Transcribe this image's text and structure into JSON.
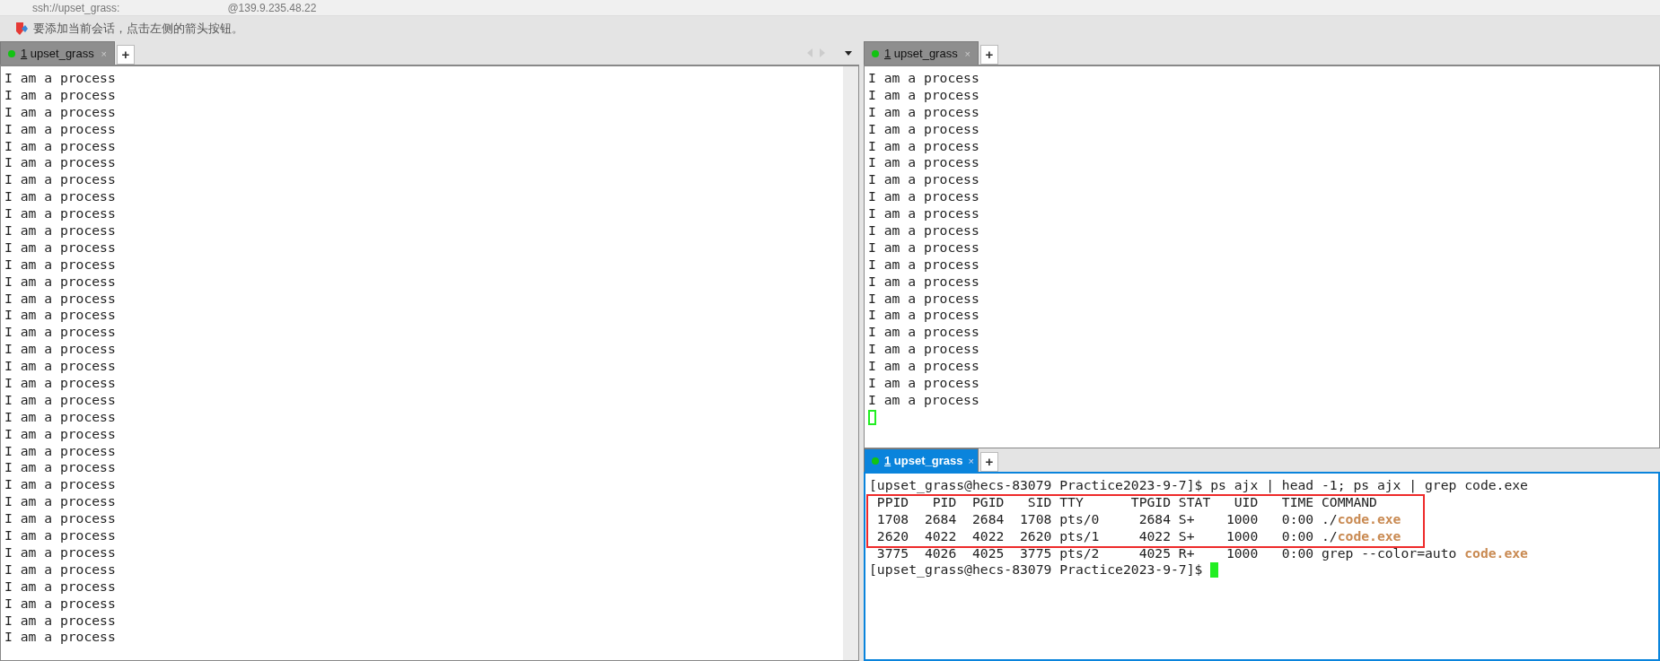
{
  "session_bar": {
    "host": "ssh://upset_grass:",
    "address": "@139.9.235.48.22"
  },
  "hint_bar": {
    "text": "要添加当前会话，点击左侧的箭头按钮。"
  },
  "left_pane": {
    "focused": false,
    "scrollbar": true,
    "tab_nav": true,
    "tabs": [
      {
        "number": "1",
        "label": "upset_grass",
        "close": "×",
        "selected": true
      }
    ],
    "new_tab": "+",
    "lines": [
      [
        {
          "text": "I am a process",
          "kind": "plain"
        }
      ],
      [
        {
          "text": "I am a process",
          "kind": "plain"
        }
      ],
      [
        {
          "text": "I am a process",
          "kind": "plain"
        }
      ],
      [
        {
          "text": "I am a process",
          "kind": "plain"
        }
      ],
      [
        {
          "text": "I am a process",
          "kind": "plain"
        }
      ],
      [
        {
          "text": "I am a process",
          "kind": "plain"
        }
      ],
      [
        {
          "text": "I am a process",
          "kind": "plain"
        }
      ],
      [
        {
          "text": "I am a process",
          "kind": "plain"
        }
      ],
      [
        {
          "text": "I am a process",
          "kind": "plain"
        }
      ],
      [
        {
          "text": "I am a process",
          "kind": "plain"
        }
      ],
      [
        {
          "text": "I am a process",
          "kind": "plain"
        }
      ],
      [
        {
          "text": "I am a process",
          "kind": "plain"
        }
      ],
      [
        {
          "text": "I am a process",
          "kind": "plain"
        }
      ],
      [
        {
          "text": "I am a process",
          "kind": "plain"
        }
      ],
      [
        {
          "text": "I am a process",
          "kind": "plain"
        }
      ],
      [
        {
          "text": "I am a process",
          "kind": "plain"
        }
      ],
      [
        {
          "text": "I am a process",
          "kind": "plain"
        }
      ],
      [
        {
          "text": "I am a process",
          "kind": "plain"
        }
      ],
      [
        {
          "text": "I am a process",
          "kind": "plain"
        }
      ],
      [
        {
          "text": "I am a process",
          "kind": "plain"
        }
      ],
      [
        {
          "text": "I am a process",
          "kind": "plain"
        }
      ],
      [
        {
          "text": "I am a process",
          "kind": "plain"
        }
      ],
      [
        {
          "text": "I am a process",
          "kind": "plain"
        }
      ],
      [
        {
          "text": "I am a process",
          "kind": "plain"
        }
      ],
      [
        {
          "text": "I am a process",
          "kind": "plain"
        }
      ],
      [
        {
          "text": "I am a process",
          "kind": "plain"
        }
      ],
      [
        {
          "text": "I am a process",
          "kind": "plain"
        }
      ],
      [
        {
          "text": "I am a process",
          "kind": "plain"
        }
      ],
      [
        {
          "text": "I am a process",
          "kind": "plain"
        }
      ],
      [
        {
          "text": "I am a process",
          "kind": "plain"
        }
      ],
      [
        {
          "text": "I am a process",
          "kind": "plain"
        }
      ],
      [
        {
          "text": "I am a process",
          "kind": "plain"
        }
      ],
      [
        {
          "text": "I am a process",
          "kind": "plain"
        }
      ],
      [
        {
          "text": "I am a process",
          "kind": "plain"
        }
      ]
    ]
  },
  "right_panes": [
    {
      "focused": false,
      "tabs": [
        {
          "number": "1",
          "label": "upset_grass",
          "close": "×",
          "selected": true
        }
      ],
      "new_tab": "+",
      "cursor_shown": true,
      "cursor_filled": false,
      "lines": [
        [
          {
            "text": "I am a process",
            "kind": "plain"
          }
        ],
        [
          {
            "text": "I am a process",
            "kind": "plain"
          }
        ],
        [
          {
            "text": "I am a process",
            "kind": "plain"
          }
        ],
        [
          {
            "text": "I am a process",
            "kind": "plain"
          }
        ],
        [
          {
            "text": "I am a process",
            "kind": "plain"
          }
        ],
        [
          {
            "text": "I am a process",
            "kind": "plain"
          }
        ],
        [
          {
            "text": "I am a process",
            "kind": "plain"
          }
        ],
        [
          {
            "text": "I am a process",
            "kind": "plain"
          }
        ],
        [
          {
            "text": "I am a process",
            "kind": "plain"
          }
        ],
        [
          {
            "text": "I am a process",
            "kind": "plain"
          }
        ],
        [
          {
            "text": "I am a process",
            "kind": "plain"
          }
        ],
        [
          {
            "text": "I am a process",
            "kind": "plain"
          }
        ],
        [
          {
            "text": "I am a process",
            "kind": "plain"
          }
        ],
        [
          {
            "text": "I am a process",
            "kind": "plain"
          }
        ],
        [
          {
            "text": "I am a process",
            "kind": "plain"
          }
        ],
        [
          {
            "text": "I am a process",
            "kind": "plain"
          }
        ],
        [
          {
            "text": "I am a process",
            "kind": "plain"
          }
        ],
        [
          {
            "text": "I am a process",
            "kind": "plain"
          }
        ],
        [
          {
            "text": "I am a process",
            "kind": "plain"
          }
        ],
        [
          {
            "text": "I am a process",
            "kind": "plain"
          }
        ]
      ]
    },
    {
      "focused": true,
      "tabs": [
        {
          "number": "1",
          "label": "upset_grass",
          "close": "×",
          "selected": true
        }
      ],
      "new_tab": "+",
      "cursor_shown": true,
      "cursor_filled": true,
      "lines": [
        [
          {
            "text": "[upset_grass@hecs-83079 Practice2023-9-7]$ ps ajx | head -1; ps ajx | grep code.exe",
            "kind": "plain"
          }
        ],
        [
          {
            "text": " PPID   PID  PGID   SID TTY      TPGID STAT   UID   TIME COMMAND",
            "kind": "plain",
            "highlighted": true
          }
        ],
        [
          {
            "text": " 1708  2684  2684  1708 pts/0     2684 S+    1000   0:00 ./",
            "kind": "plain",
            "highlighted": true
          },
          {
            "text": "code.exe",
            "kind": "match"
          }
        ],
        [
          {
            "text": " 2620  4022  4022  2620 pts/1     4022 S+    1000   0:00 ./",
            "kind": "plain",
            "highlighted": true
          },
          {
            "text": "code.exe",
            "kind": "match"
          }
        ],
        [
          {
            "text": " 3775  4026  4025  3775 pts/2     4025 R+    1000   0:00 grep --color=auto ",
            "kind": "plain"
          },
          {
            "text": "code.exe",
            "kind": "match"
          }
        ],
        [
          {
            "text": "[upset_grass@hecs-83079 Practice2023-9-7]$ ",
            "kind": "plain"
          }
        ]
      ]
    }
  ]
}
